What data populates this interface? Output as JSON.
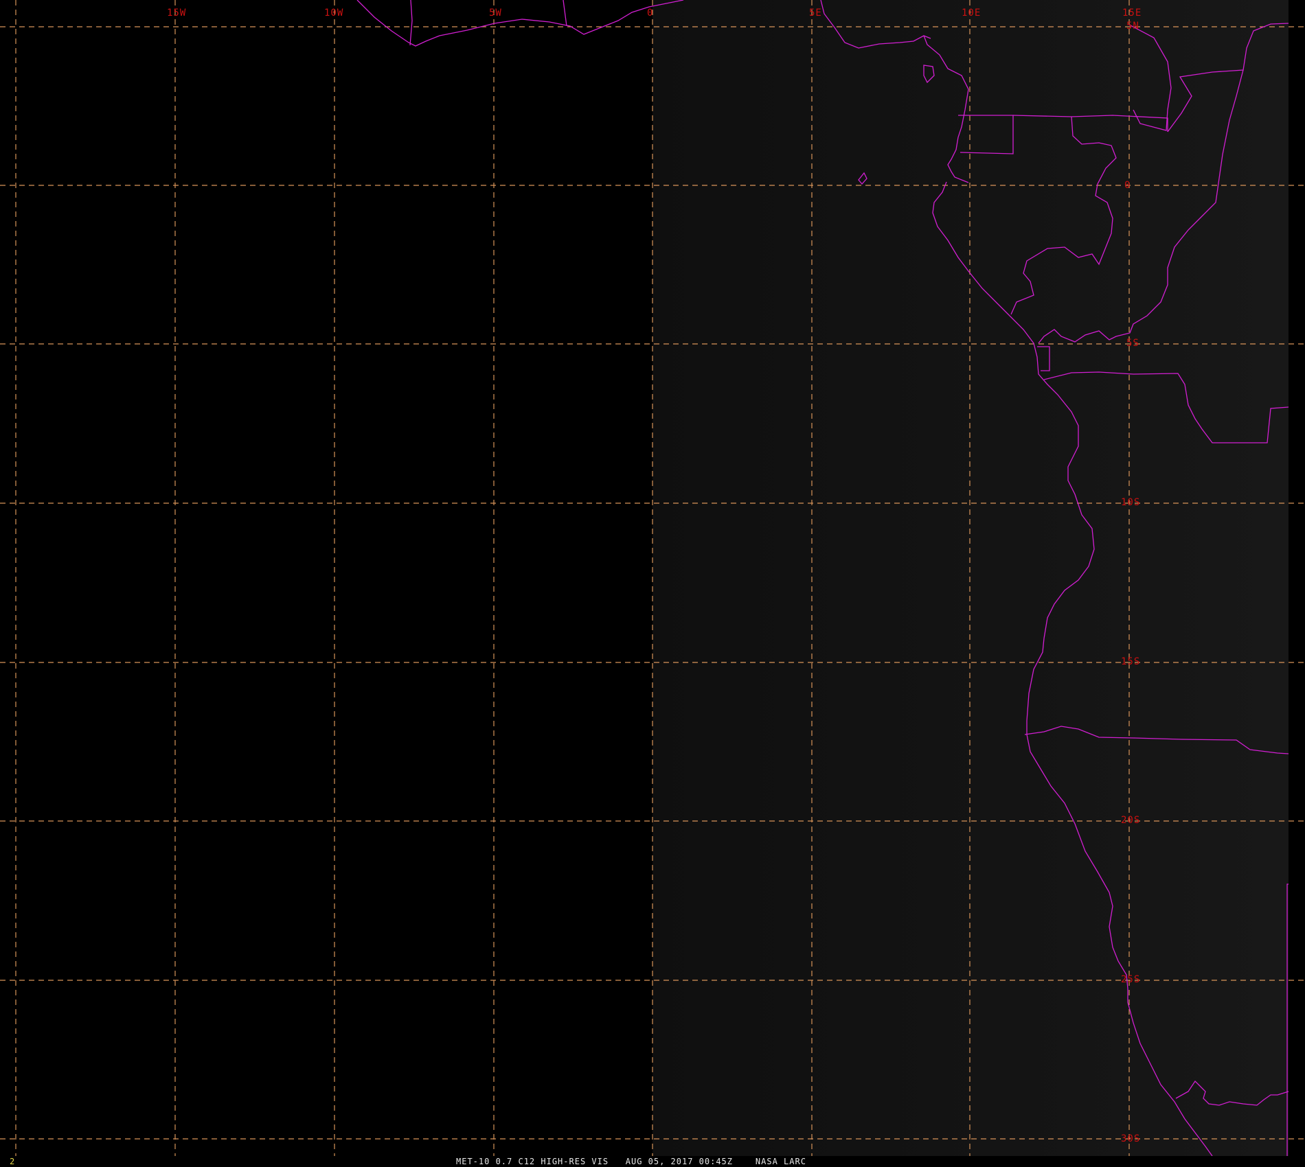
{
  "map": {
    "lon_labels": [
      "15W",
      "10W",
      "5W",
      "0",
      "5E",
      "10E",
      "15E"
    ],
    "lat_labels": [
      "5N",
      "0",
      "5S",
      "10S",
      "15S",
      "20S",
      "25S",
      "30S"
    ],
    "colors": {
      "background_left": "#000000",
      "background_right": "#151515",
      "grid": "#d9955a",
      "labels": "#cc1111",
      "borders": "#d21fd2",
      "frame_number": "#e6d84a",
      "status_text": "#e8e8e8"
    }
  },
  "caption": {
    "frame_number": "2",
    "status_line": "MET-10 0.7 C12 HIGH-RES VIS   AUG 05, 2017 00:45Z    NASA LARC"
  }
}
